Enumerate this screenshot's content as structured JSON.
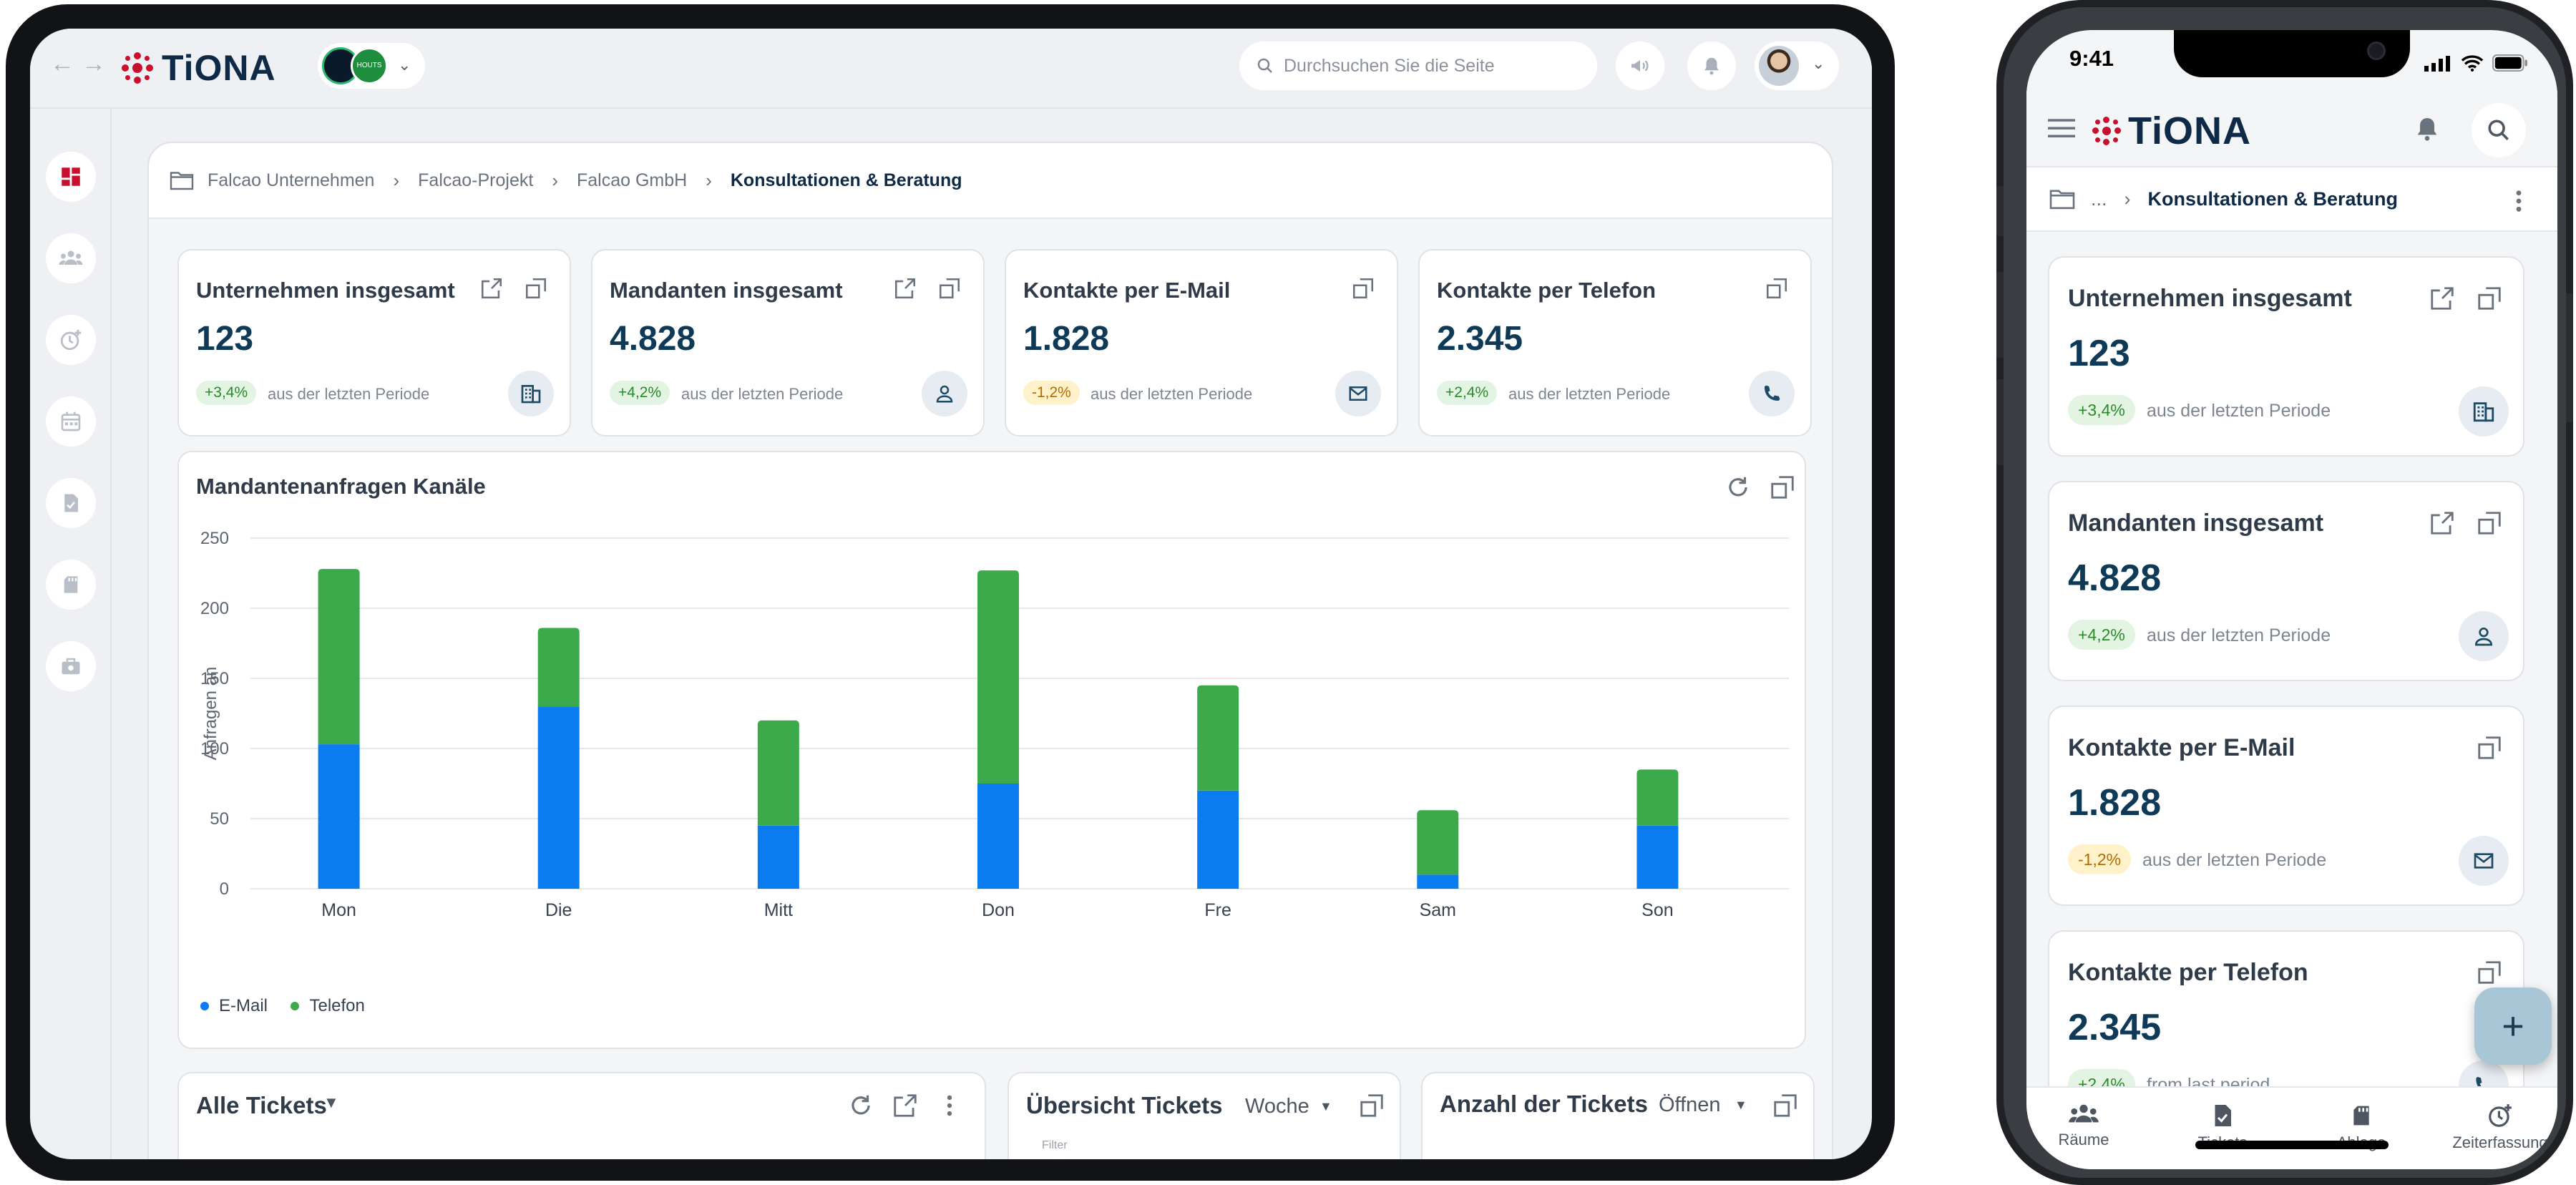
{
  "app": {
    "logo_text": "TiONA",
    "brand_color": "#c8102e",
    "primary_color": "#0e2a47"
  },
  "tablet": {
    "header": {
      "search_placeholder": "Durchsuchen Sie die Seite",
      "org_badge_text": "HOUTS"
    },
    "breadcrumb": [
      "Falcao Unternehmen",
      "Falcao-Projekt",
      "Falcao GmbH",
      "Konsultationen & Beratung"
    ],
    "stats": [
      {
        "title": "Unternehmen insgesamt",
        "value": "123",
        "change": "+3,4%",
        "trend": "positive",
        "subtitle": "aus der letzten Periode",
        "icon": "building-icon"
      },
      {
        "title": "Mandanten insgesamt",
        "value": "4.828",
        "change": "+4,2%",
        "trend": "positive",
        "subtitle": "aus der letzten Periode",
        "icon": "person-icon"
      },
      {
        "title": "Kontakte per E-Mail",
        "value": "1.828",
        "change": "-1,2%",
        "trend": "negative",
        "subtitle": "aus der letzten Periode",
        "icon": "mail-icon"
      },
      {
        "title": "Kontakte per Telefon",
        "value": "2.345",
        "change": "+2,4%",
        "trend": "positive",
        "subtitle": "aus der letzten Periode",
        "icon": "phone-icon"
      }
    ],
    "chart_card": {
      "title": "Mandantenanfragen Kanäle"
    },
    "bottom_cards": [
      {
        "title": "Alle Tickets"
      },
      {
        "title": "Übersicht Tickets",
        "dropdown": "Woche",
        "filter_label": "Filter"
      },
      {
        "title": "Anzahl der Tickets",
        "dropdown": "Öffnen"
      }
    ]
  },
  "chart_data": {
    "type": "bar",
    "stacked": true,
    "categories": [
      "Mon",
      "Die",
      "Mitt",
      "Don",
      "Fre",
      "Sam",
      "Son"
    ],
    "series": [
      {
        "name": "E-Mail",
        "color": "#0a7cf0",
        "values": [
          103,
          130,
          45,
          75,
          70,
          10,
          45
        ]
      },
      {
        "name": "Telefon",
        "color": "#3caa4a",
        "values": [
          125,
          56,
          75,
          152,
          75,
          46,
          40
        ]
      }
    ],
    "title": "Mandantenanfragen Kanäle",
    "xlabel": "",
    "ylabel": "Anfragen an",
    "ylim": [
      0,
      250
    ],
    "yticks": [
      0,
      50,
      100,
      150,
      200,
      250
    ],
    "grid": true,
    "legend": "bottom-left"
  },
  "phone": {
    "status_time": "9:41",
    "breadcrumb": {
      "ellipsis": "...",
      "current": "Konsultationen & Beratung"
    },
    "stats": [
      {
        "title": "Unternehmen insgesamt",
        "value": "123",
        "change": "+3,4%",
        "trend": "positive",
        "subtitle": "aus der letzten Periode"
      },
      {
        "title": "Mandanten insgesamt",
        "value": "4.828",
        "change": "+4,2%",
        "trend": "positive",
        "subtitle": "aus der letzten Periode"
      },
      {
        "title": "Kontakte per E-Mail",
        "value": "1.828",
        "change": "-1,2%",
        "trend": "negative",
        "subtitle": "aus der letzten Periode"
      },
      {
        "title": "Kontakte per Telefon",
        "value": "2.345",
        "change": "+2,4%",
        "trend": "positive",
        "subtitle": "from last period"
      }
    ],
    "fab_label": "+",
    "tabs": [
      "Räume",
      "Tickets",
      "Ablage",
      "Zeiterfassung"
    ]
  }
}
